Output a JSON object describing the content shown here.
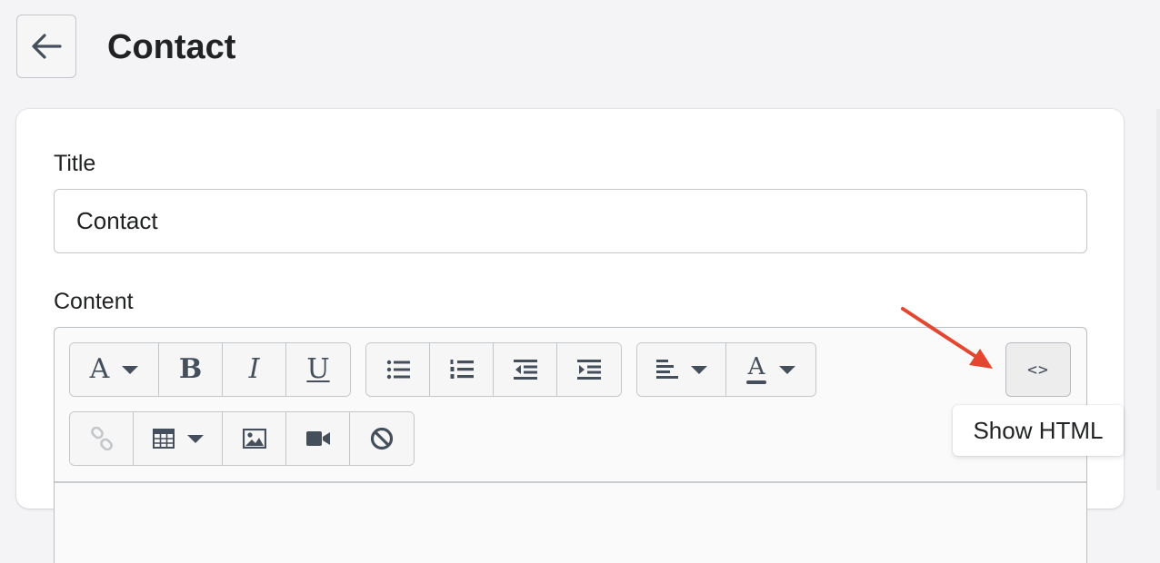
{
  "header": {
    "back_icon": "arrow-left-icon",
    "title": "Contact"
  },
  "form": {
    "title_label": "Title",
    "title_value": "Contact",
    "content_label": "Content"
  },
  "toolbar": {
    "row1": {
      "style": {
        "glyph": "A",
        "icon": "font-style-icon"
      },
      "bold": {
        "glyph": "B",
        "icon": "bold-icon"
      },
      "italic": {
        "glyph": "I",
        "icon": "italic-icon"
      },
      "underline": {
        "glyph": "U",
        "icon": "underline-icon"
      },
      "lists": [
        "bulleted-list-icon",
        "numbered-list-icon",
        "outdent-icon",
        "indent-icon"
      ],
      "align": {
        "icon": "align-left-icon"
      },
      "text_color": {
        "glyph": "A",
        "icon": "text-color-icon"
      },
      "show_html": {
        "glyph": "<>",
        "icon": "code-icon"
      }
    },
    "row2": [
      "link-icon",
      "table-icon",
      "image-icon",
      "video-icon",
      "clear-format-icon"
    ]
  },
  "tooltip": {
    "text": "Show HTML"
  },
  "colors": {
    "annotation_arrow": "#e5462f",
    "page_background": "#f4f4f6",
    "text": "#202223",
    "icon": "#454f5b"
  }
}
